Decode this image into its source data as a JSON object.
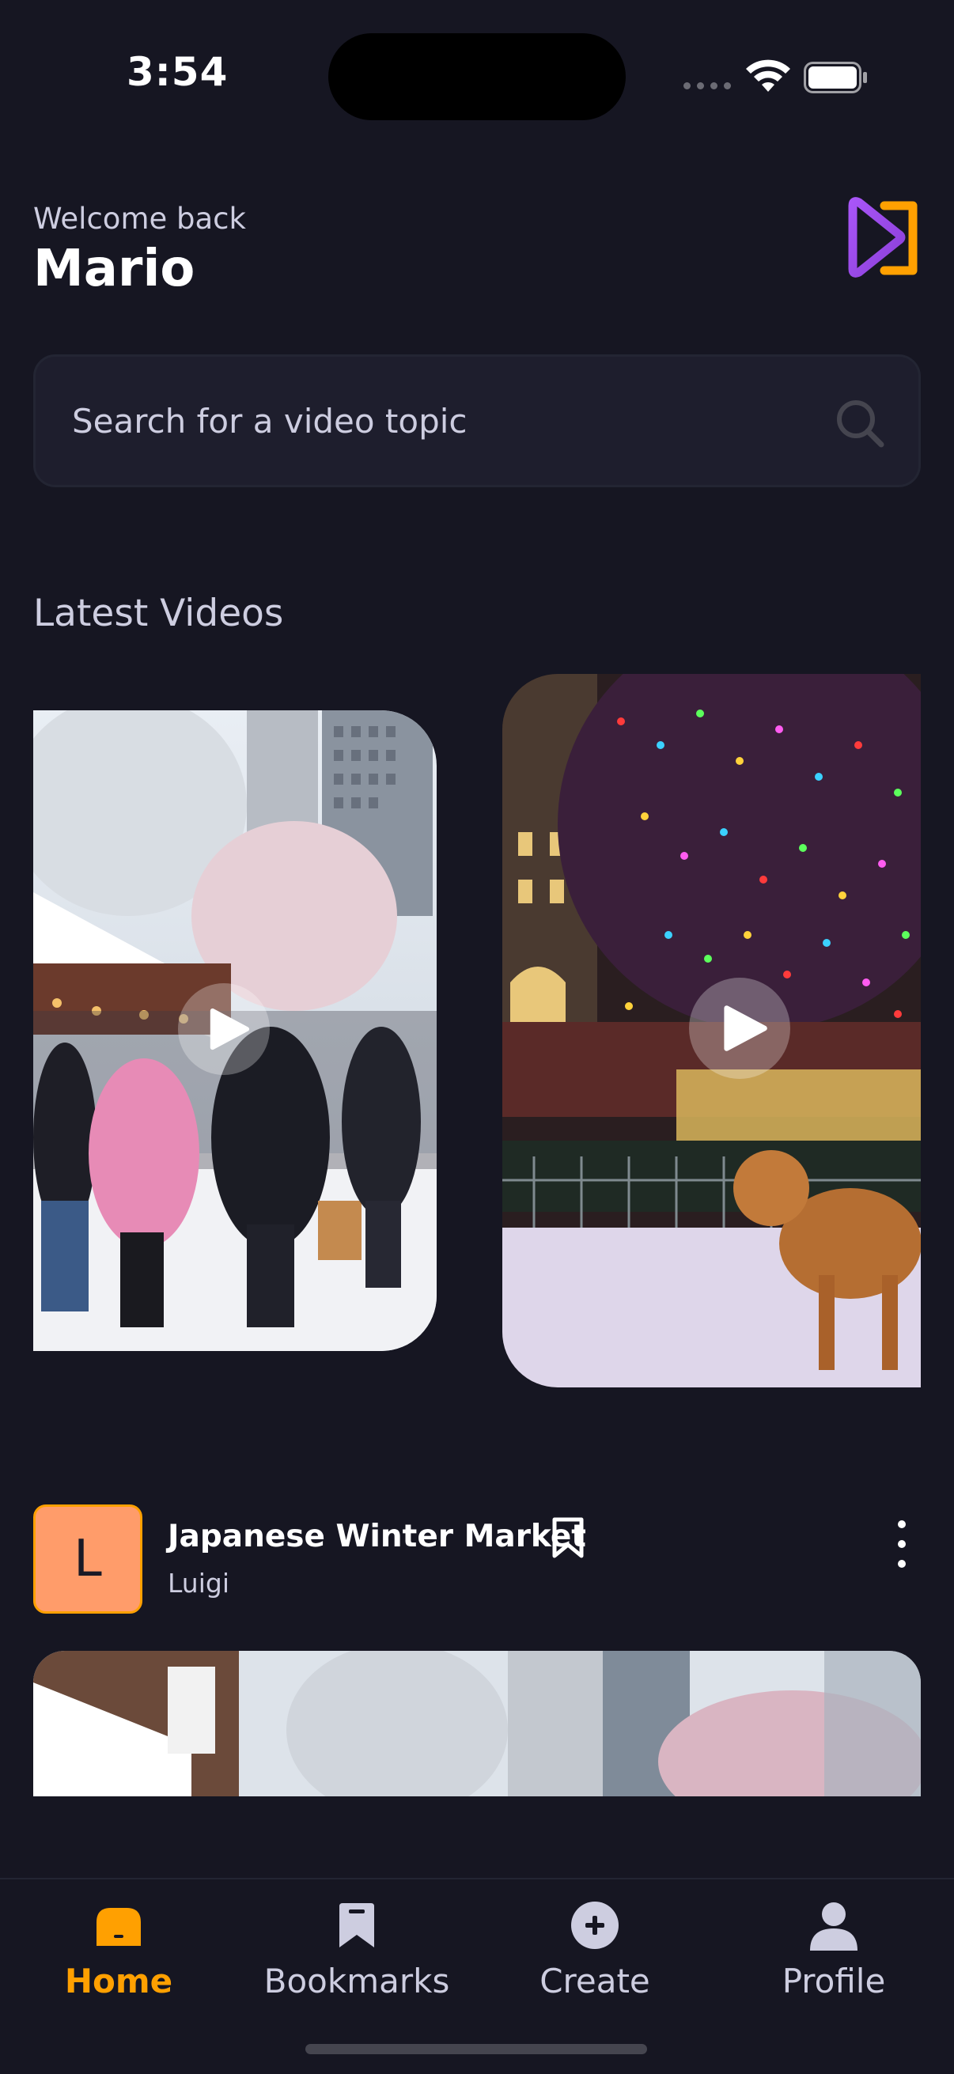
{
  "status_bar": {
    "time": "3:54"
  },
  "header": {
    "welcome": "Welcome back",
    "username": "Mario"
  },
  "search": {
    "placeholder": "Search for a video topic"
  },
  "latest": {
    "title": "Latest Videos"
  },
  "video_card": {
    "avatar_letter": "L",
    "title": "Japanese Winter Market",
    "creator": "Luigi"
  },
  "tabs": [
    {
      "label": "Home",
      "icon": "home-icon",
      "active": true
    },
    {
      "label": "Bookmarks",
      "icon": "bookmark-icon",
      "active": false
    },
    {
      "label": "Create",
      "icon": "plus-icon",
      "active": false
    },
    {
      "label": "Profile",
      "icon": "profile-icon",
      "active": false
    }
  ],
  "colors": {
    "background": "#161622",
    "accent": "#ffa001",
    "surface": "#1e1e2d",
    "muted": "#cdcde0",
    "avatar": "#ff9c6a"
  }
}
